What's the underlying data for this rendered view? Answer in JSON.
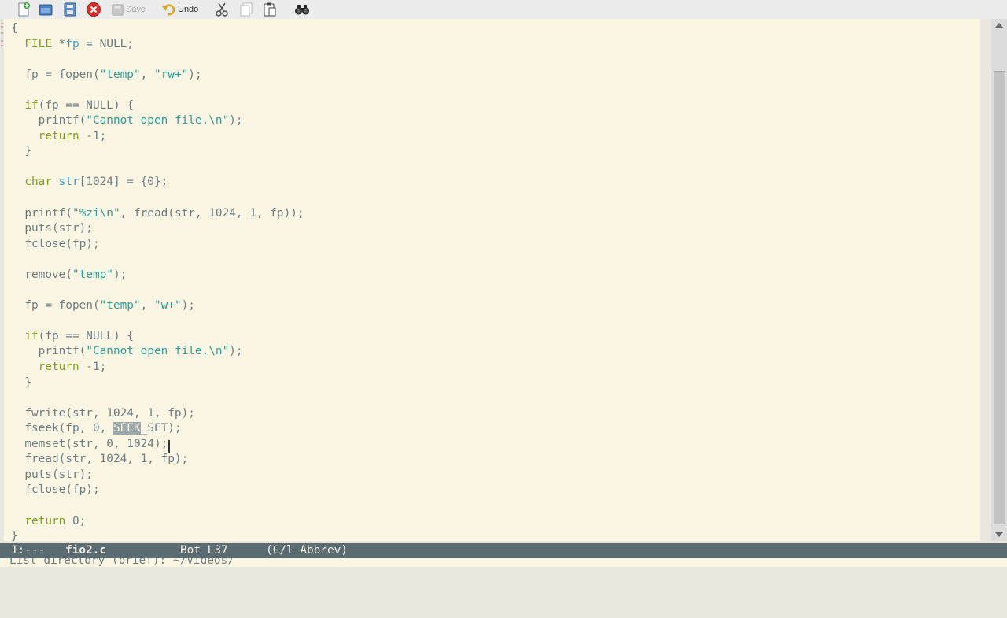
{
  "toolbar": {
    "save_label": "Save",
    "undo_label": "Undo",
    "icons": [
      "new-file-icon",
      "open-folder-icon",
      "save-file-icon",
      "close-buffer-icon",
      "save-icon",
      "undo-icon",
      "cut-icon",
      "copy-icon",
      "paste-icon",
      "search-binoculars-icon"
    ]
  },
  "editor": {
    "lines": [
      [
        {
          "t": "{"
        }
      ],
      [
        {
          "t": "  "
        },
        {
          "t": "FILE",
          "c": "kw"
        },
        {
          "t": " *"
        },
        {
          "t": "fp",
          "c": "var"
        },
        {
          "t": " = NULL;"
        }
      ],
      [],
      [
        {
          "t": "  fp = fopen("
        },
        {
          "t": "\"temp\"",
          "c": "str"
        },
        {
          "t": ", "
        },
        {
          "t": "\"rw+\"",
          "c": "str"
        },
        {
          "t": ");"
        }
      ],
      [],
      [
        {
          "t": "  "
        },
        {
          "t": "if",
          "c": "kw"
        },
        {
          "t": "(fp == NULL) {"
        }
      ],
      [
        {
          "t": "    printf("
        },
        {
          "t": "\"Cannot open file.\\n\"",
          "c": "str"
        },
        {
          "t": ");"
        }
      ],
      [
        {
          "t": "    "
        },
        {
          "t": "return",
          "c": "kw"
        },
        {
          "t": " -1;"
        }
      ],
      [
        {
          "t": "  }"
        }
      ],
      [],
      [
        {
          "t": "  "
        },
        {
          "t": "char",
          "c": "kw"
        },
        {
          "t": " "
        },
        {
          "t": "str",
          "c": "var"
        },
        {
          "t": "[1024] = {0};"
        }
      ],
      [],
      [
        {
          "t": "  printf("
        },
        {
          "t": "\"%zi\\n\"",
          "c": "str"
        },
        {
          "t": ", fread(str, 1024, 1, fp));"
        }
      ],
      [
        {
          "t": "  puts(str);"
        }
      ],
      [
        {
          "t": "  fclose(fp);"
        }
      ],
      [],
      [
        {
          "t": "  remove("
        },
        {
          "t": "\"temp\"",
          "c": "str"
        },
        {
          "t": ");"
        }
      ],
      [],
      [
        {
          "t": "  fp = fopen("
        },
        {
          "t": "\"temp\"",
          "c": "str"
        },
        {
          "t": ", "
        },
        {
          "t": "\"w+\"",
          "c": "str"
        },
        {
          "t": ");"
        }
      ],
      [],
      [
        {
          "t": "  "
        },
        {
          "t": "if",
          "c": "kw"
        },
        {
          "t": "(fp == NULL) {"
        }
      ],
      [
        {
          "t": "    printf("
        },
        {
          "t": "\"Cannot open file.\\n\"",
          "c": "str"
        },
        {
          "t": ");"
        }
      ],
      [
        {
          "t": "    "
        },
        {
          "t": "return",
          "c": "kw"
        },
        {
          "t": " -1;"
        }
      ],
      [
        {
          "t": "  }"
        }
      ],
      [],
      [
        {
          "t": "  fwrite(str, 1024, 1, fp);"
        }
      ],
      [
        {
          "t": "  fseek(fp, 0, "
        },
        {
          "t": "SEEK",
          "c": "region"
        },
        {
          "t": "_SET);"
        }
      ],
      [
        {
          "t": "  memset(str, 0, 1024);"
        }
      ],
      [
        {
          "t": "  fread(str, 1024, 1, fp);"
        }
      ],
      [
        {
          "t": "  puts(str);"
        }
      ],
      [
        {
          "t": "  fclose(fp);"
        }
      ],
      [],
      [
        {
          "t": "  "
        },
        {
          "t": "return",
          "c": "kw"
        },
        {
          "t": " 0;"
        }
      ],
      [
        {
          "t": "}"
        }
      ]
    ]
  },
  "mode_line": {
    "status": "1:---",
    "buffer_name": "fio2.c",
    "position": "Bot L37",
    "modes": "(C/l Abbrev)"
  },
  "minibuffer": {
    "prompt": "List directory (brief): ~/Videos/"
  },
  "colors": {
    "editor_bg": "#fbf5e4",
    "text": "#6e7d80",
    "keyword": "#7f9f1e",
    "variable": "#3e9ac8",
    "string": "#2aa198",
    "mode_line_bg": "#5a6c71"
  }
}
